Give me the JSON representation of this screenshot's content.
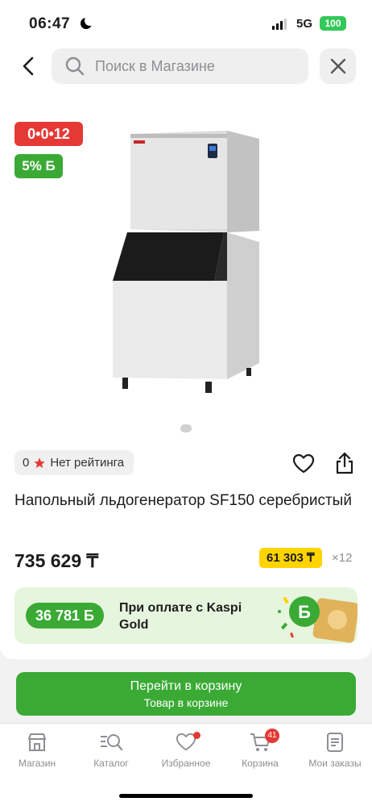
{
  "status_bar": {
    "time": "06:47",
    "network": "5G",
    "battery": "100"
  },
  "search": {
    "placeholder": "Поиск в Магазине",
    "value": ""
  },
  "icons": {
    "back": "chevron-left-icon",
    "search": "search-icon",
    "close": "close-icon",
    "favorite": "heart-icon",
    "share": "share-icon",
    "star": "star-icon"
  },
  "badges": {
    "timer": "0•0•12",
    "bonus_percent": "5% Б"
  },
  "rating": {
    "value": "0",
    "text": "Нет рейтинга"
  },
  "product": {
    "title": "Напольный льдогенератор SF150 серебристый",
    "price": "735 629 ₸",
    "installment_price": "61 303 ₸",
    "installment_months": "×12"
  },
  "kaspi_gold": {
    "bonus": "36 781 Б",
    "text": "При оплате с Kaspi Gold"
  },
  "cta": {
    "main": "Перейти в корзину",
    "sub": "Товар в корзине"
  },
  "tabs": [
    {
      "label": "Магазин",
      "icon": "store-icon"
    },
    {
      "label": "Каталог",
      "icon": "catalog-search-icon"
    },
    {
      "label": "Избранное",
      "icon": "heart-icon",
      "dot": true
    },
    {
      "label": "Корзина",
      "icon": "cart-icon",
      "badge": "41"
    },
    {
      "label": "Мои заказы",
      "icon": "orders-icon"
    }
  ],
  "colors": {
    "brand_green": "#3aaa35",
    "timer_red": "#e53935",
    "installment_yellow": "#ffd400",
    "gold_banner_bg": "#e6f5dd"
  }
}
